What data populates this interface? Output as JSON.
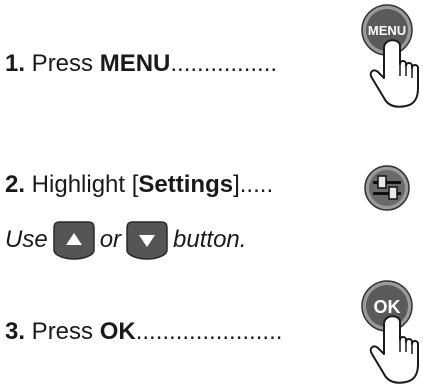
{
  "steps": [
    {
      "num": "1.",
      "pre": " Press ",
      "key": "MENU",
      "post": "",
      "dots": "................"
    },
    {
      "num": "2.",
      "pre": " Highlight [",
      "key": "Settings",
      "post": "]",
      "dots": "....."
    },
    {
      "num": "3.",
      "pre": " Press ",
      "key": "OK",
      "post": "",
      "dots": "......................"
    }
  ],
  "hint": {
    "use": "Use",
    "or": "or",
    "button": "button."
  },
  "icons": {
    "menu_button_label": "MENU",
    "ok_button_label": "OK",
    "settings_icon": "settings-sliders-icon",
    "up_button_icon": "up-arrow-icon",
    "down_button_icon": "down-arrow-icon",
    "hand_icon": "pointing-hand-icon"
  },
  "colors": {
    "button_fill": "#5a5a5a",
    "button_ring": "#9a9a9a",
    "text": "#1a1a1a"
  }
}
